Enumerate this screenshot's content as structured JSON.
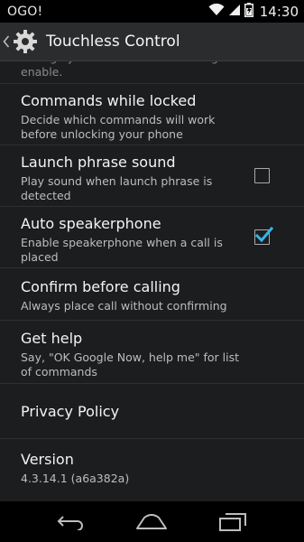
{
  "status_bar": {
    "carrier": "OGO!",
    "time": "14:30",
    "icons": [
      "wifi-icon",
      "signal-icon",
      "battery-icon"
    ]
  },
  "action_bar": {
    "title": "Touchless Control",
    "icons": [
      "up-caret-icon",
      "gear-icon"
    ]
  },
  "settings": {
    "partial_item": {
      "summary": "Change your screen lock in Settings to enable."
    },
    "commands_while_locked": {
      "title": "Commands while locked",
      "summary": "Decide which commands will work before unlocking your phone"
    },
    "launch_phrase_sound": {
      "title": "Launch phrase sound",
      "summary": "Play sound when launch phrase is detected",
      "checked": false
    },
    "auto_speakerphone": {
      "title": "Auto speakerphone",
      "summary": "Enable speakerphone when a call is placed",
      "checked": true
    },
    "confirm_before_calling": {
      "title": "Confirm before calling",
      "summary": "Always place call without confirming"
    },
    "get_help": {
      "title": "Get help",
      "summary": "Say, \"OK Google Now, help me\" for list of commands"
    },
    "privacy_policy": {
      "title": "Privacy Policy"
    },
    "version": {
      "title": "Version",
      "summary": "4.3.14.1 (a6a382a)"
    }
  },
  "colors": {
    "accent": "#33b5e5",
    "background": "#1c1d1f",
    "action_bar": "#2b2c2e"
  },
  "nav_bar": {
    "icons": [
      "back-icon",
      "home-icon",
      "recents-icon"
    ]
  }
}
